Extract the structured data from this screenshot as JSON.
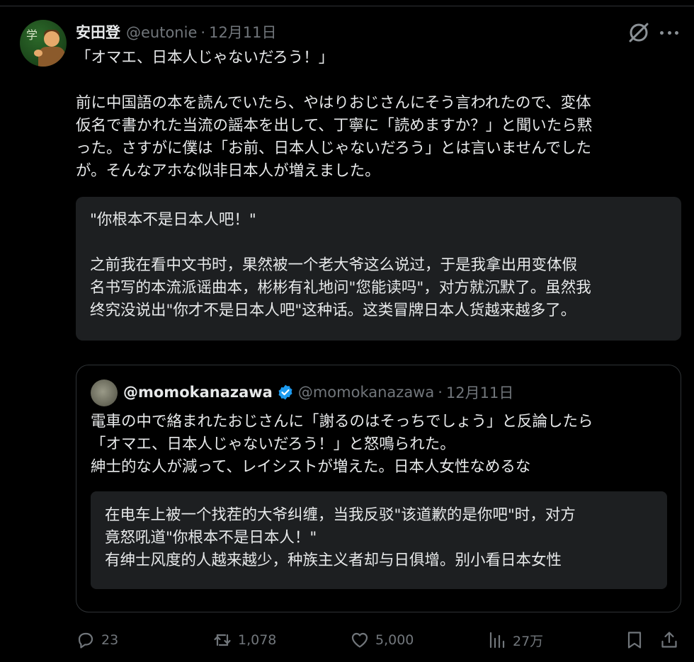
{
  "post": {
    "author": {
      "display_name": "安田登",
      "handle": "@eutonie",
      "separator": "·",
      "date": "12月11日"
    },
    "text": "「オマエ、日本人じゃないだろう！」\n\n前に中国語の本を読んでいたら、やはりおじさんにそう言われたので、変体\n仮名で書かれた当流の謡本を出して、丁寧に「読めますか？」と聞いたら黙\nった。さすがに僕は「お前、日本人じゃないだろう」とは言いませんでした\nが。そんなアホな似非日本人が増えました。",
    "translation": "\"你根本不是日本人吧！\"\n\n之前我在看中文书时，果然被一个老大爷这么说过，于是我拿出用变体假\n名书写的本流派谣曲本，彬彬有礼地问\"您能读吗\"，对方就沉默了。虽然我\n终究没说出\"你才不是日本人吧\"这种话。这类冒牌日本人货越来越多了。",
    "icons": {
      "menu": "grok-icon",
      "more": "more-icon"
    }
  },
  "quoted_post": {
    "display_name": "@momokanazawa",
    "handle": "@momokanazawa",
    "separator": "·",
    "date": "12月11日",
    "verified": true,
    "text": "電車の中で絡まれたおじさんに「謝るのはそっちでしょう」と反論したら\n「オマエ、日本人じゃないだろう！」と怒鳴られた。\n紳士的な人が減って、レイシストが増えた。日本人女性なめるな",
    "translation": "在电车上被一个找茬的大爷纠缠，当我反驳\"该道歉的是你吧\"时，对方\n竟怒吼道\"你根本不是日本人！\"\n有绅士风度的人越来越少，种族主义者却与日俱增。别小看日本女性"
  },
  "actions": {
    "replies": "23",
    "retweets": "1,078",
    "likes": "5,000",
    "views": "27万"
  },
  "colors": {
    "background": "#000000",
    "text": "#e7e9ea",
    "muted": "#71767b",
    "card": "#1d1f21",
    "border": "#2f3336",
    "verified": "#1d9bf0"
  }
}
